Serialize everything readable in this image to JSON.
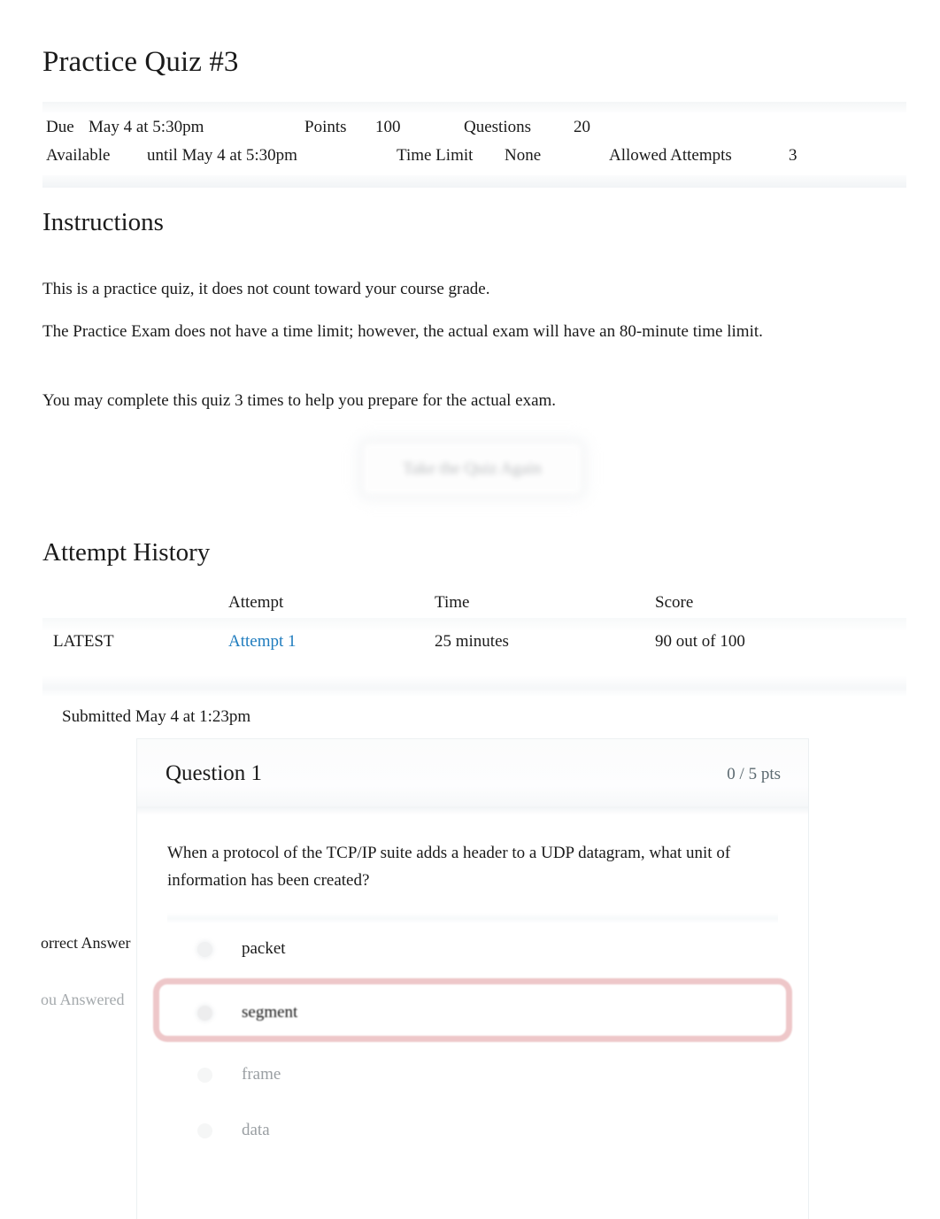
{
  "quiz": {
    "title": "Practice Quiz #3"
  },
  "meta": {
    "due_label": "Due",
    "due_value": "May 4 at 5:30pm",
    "points_label": "Points",
    "points_value": "100",
    "questions_label": "Questions",
    "questions_value": "20",
    "available_label": "Available",
    "available_value": "until May 4 at 5:30pm",
    "time_limit_label": "Time Limit",
    "time_limit_value": "None",
    "allowed_attempts_label": "Allowed Attempts",
    "allowed_attempts_value": "3"
  },
  "instructions": {
    "heading": "Instructions",
    "p1": "This is a practice quiz, it does not count toward your course grade.",
    "p2": "The Practice Exam does not have a time limit; however, the actual exam will have an 80-minute time limit.",
    "p3": "You may complete this quiz 3 times to help you prepare for the actual exam."
  },
  "actions": {
    "retake_label": "Take the Quiz Again"
  },
  "attempt_history": {
    "heading": "Attempt History",
    "columns": [
      "",
      "Attempt",
      "Time",
      "Score"
    ],
    "rows": [
      {
        "marker": "LATEST",
        "attempt": "Attempt 1",
        "time": "25 minutes",
        "score": "90 out of 100"
      }
    ],
    "submitted": "Submitted May 4 at 1:23pm"
  },
  "question": {
    "title": "Question 1",
    "points": "0 / 5 pts",
    "text": "When a protocol of the TCP/IP suite adds a header to a UDP datagram, what unit of information has been created?",
    "options": [
      {
        "label": "packet",
        "state": "correct"
      },
      {
        "label": "segment",
        "state": "selected-incorrect"
      },
      {
        "label": "frame",
        "state": "dim"
      },
      {
        "label": "data",
        "state": "dim"
      }
    ],
    "gutter": {
      "correct_answer": "orrect Answer",
      "you_answered": "ou Answered"
    }
  },
  "colors": {
    "link": "#1f7cbe",
    "incorrect_outline": "#e0999c",
    "text": "#1a1a1a",
    "muted": "#9a9fa3"
  }
}
